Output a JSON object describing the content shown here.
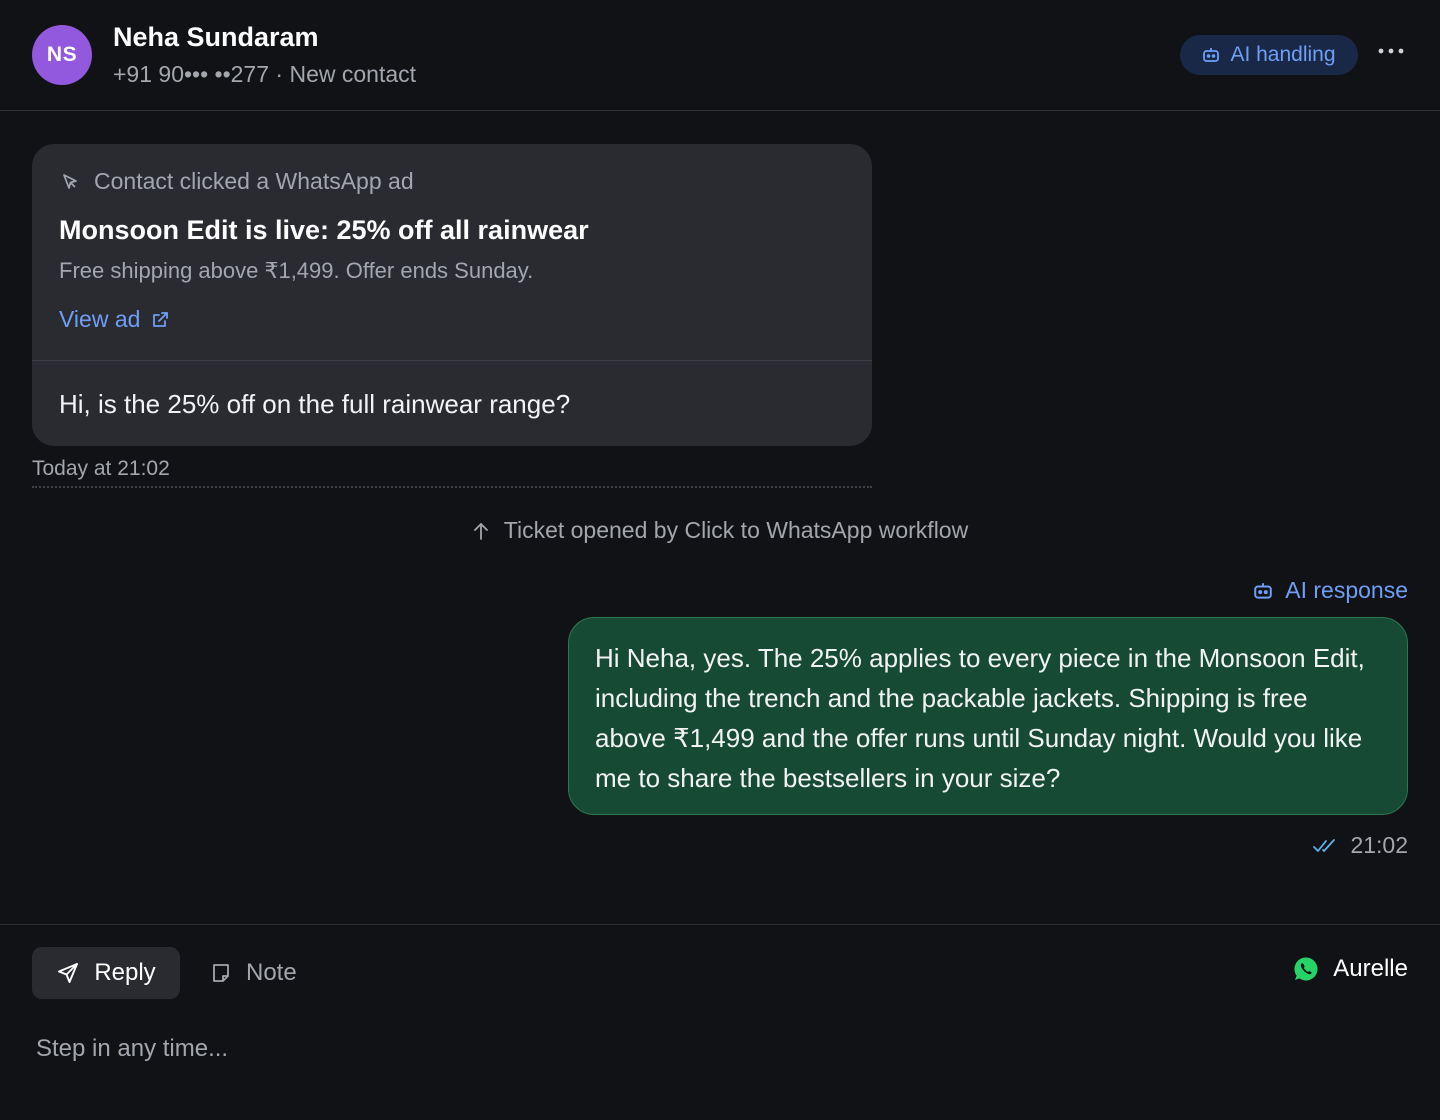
{
  "contact": {
    "initials": "NS",
    "name": "Neha Sundaram",
    "meta": "+91 90••• ••277 · New contact"
  },
  "header": {
    "ai_pill_label": "AI handling",
    "more_icon": "more-horizontal-icon"
  },
  "ad_card": {
    "source": "Contact clicked a WhatsApp ad",
    "title": "Monsoon Edit is live: 25% off all rainwear",
    "description": "Free shipping above ₹1,499. Offer ends Sunday.",
    "link_label": "View ad"
  },
  "incoming_message": {
    "text": "Hi, is the 25% off on the full rainwear range?",
    "timestamp": "Today at 21:02"
  },
  "system_event": {
    "text": "Ticket opened by Click to WhatsApp workflow"
  },
  "outgoing_message": {
    "label": "AI response",
    "text": "Hi Neha, yes. The 25% applies to every piece in the Monsoon Edit, including the trench and the packable jackets. Shipping is free above ₹1,499 and the offer runs until Sunday night. Would you like me to share the bestsellers in your size?",
    "time": "21:02"
  },
  "composer": {
    "reply_tab": "Reply",
    "note_tab": "Note",
    "channel_name": "Aurelle",
    "placeholder": "Step in any time..."
  },
  "colors": {
    "background": "#111216",
    "accent_blue": "#6f9ff5",
    "avatar_purple": "#9258dd",
    "outgoing_green": "#164a34",
    "whatsapp_green": "#25d366"
  }
}
